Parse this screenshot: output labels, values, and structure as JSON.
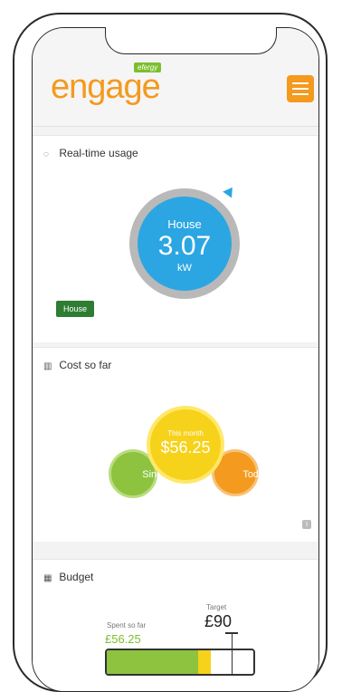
{
  "header": {
    "logo_text": "engage",
    "brand_badge": "efergy",
    "menu_icon": "hamburger-icon",
    "accent_color": "#f39a1f"
  },
  "realtime": {
    "title": "Real-time usage",
    "title_icon": "spinner-icon",
    "gauge_label": "House",
    "gauge_value": "3.07",
    "gauge_unit": "kW",
    "house_button": "House",
    "gauge_color": "#2ba6e3"
  },
  "cost": {
    "title": "Cost so far",
    "title_icon": "chart-icon",
    "month_label": "This month",
    "month_value": "$56.25",
    "since_label": "Since",
    "today_label": "Today",
    "info_icon": "i"
  },
  "budget": {
    "title": "Budget",
    "title_icon": "calculator-icon",
    "target_label": "Target",
    "target_value": "£90",
    "spent_label": "Spent so far",
    "spent_value": "£56.25",
    "spent_fraction": 0.625
  }
}
